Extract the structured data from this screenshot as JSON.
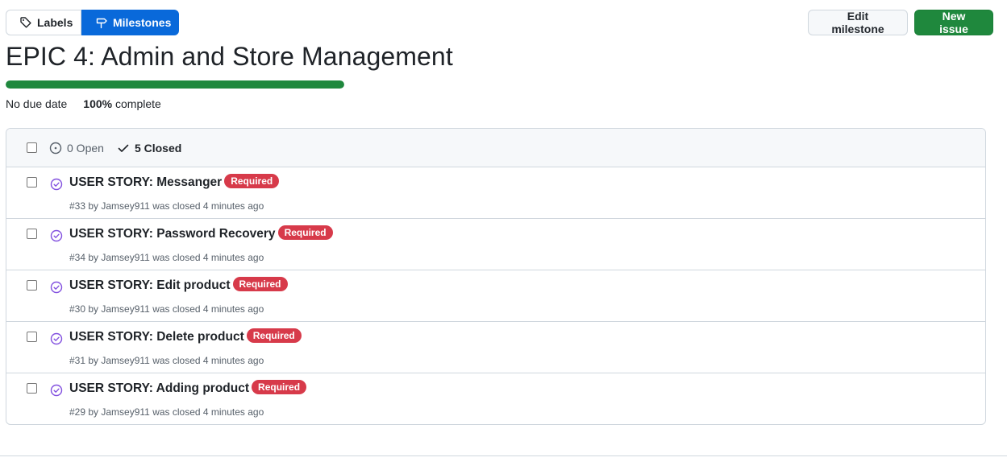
{
  "tabs": {
    "labels": "Labels",
    "milestones": "Milestones"
  },
  "actions": {
    "edit": "Edit milestone",
    "new_issue": "New issue"
  },
  "milestone": {
    "title": "EPIC 4: Admin and Store Management",
    "progress_percent": 100,
    "due": "No due date",
    "complete_value": "100%",
    "complete_label": "complete"
  },
  "filter": {
    "open": "0 Open",
    "closed": "5 Closed"
  },
  "issues": [
    {
      "title": "USER STORY: Messanger",
      "label": "Required",
      "number": "#33",
      "meta": "by Jamsey911 was closed 4 minutes ago"
    },
    {
      "title": "USER STORY: Password Recovery",
      "label": "Required",
      "number": "#34",
      "meta": "by Jamsey911 was closed 4 minutes ago"
    },
    {
      "title": "USER STORY: Edit product",
      "label": "Required",
      "number": "#30",
      "meta": "by Jamsey911 was closed 4 minutes ago"
    },
    {
      "title": "USER STORY: Delete product",
      "label": "Required",
      "number": "#31",
      "meta": "by Jamsey911 was closed 4 minutes ago"
    },
    {
      "title": "USER STORY: Adding product",
      "label": "Required",
      "number": "#29",
      "meta": "by Jamsey911 was closed 4 minutes ago"
    }
  ],
  "colors": {
    "accent": "#0969da",
    "success": "#1f883d",
    "closed_icon": "#8250df",
    "label_required": "#d73a4a"
  },
  "icons": {
    "labels": "tag-icon",
    "milestones": "milestone-icon",
    "open": "issue-open-icon",
    "closed": "check-icon",
    "issue_closed": "issue-closed-icon"
  }
}
